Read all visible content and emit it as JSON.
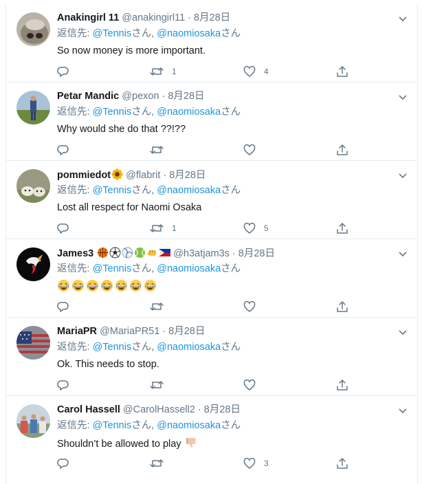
{
  "reply_prefix": "返信先: ",
  "reply_suffix": "さん",
  "reply_sep": ", ",
  "tweets": [
    {
      "name": "Anakingirl 11",
      "handle": "@anakingirl11",
      "dot": "·",
      "date": "8月28日",
      "reply_to": [
        "@Tennis",
        "@naomiosaka"
      ],
      "text": "So now money is more important.",
      "replies": "",
      "retweets": "1",
      "likes": "4"
    },
    {
      "name": "Petar Mandic",
      "handle": "@pexon",
      "dot": "·",
      "date": "8月28日",
      "reply_to": [
        "@Tennis",
        "@naomiosaka"
      ],
      "text": "Why would she do that ??!??",
      "replies": "",
      "retweets": "",
      "likes": ""
    },
    {
      "name": "pommiedot",
      "name_emoji": "sunflower-emoji",
      "handle": "@flabrit",
      "dot": "·",
      "date": "8月28日",
      "reply_to": [
        "@Tennis",
        "@naomiosaka"
      ],
      "text": "Lost all respect for Naomi Osaka",
      "replies": "",
      "retweets": "1",
      "likes": "5"
    },
    {
      "name": "James3",
      "name_emojis": [
        "basketball-emoji",
        "soccer-ball-emoji",
        "volleyball-emoji",
        "tennis-ball-emoji",
        "fist-emoji",
        "philippines-flag-emoji"
      ],
      "handle": "@h3atjam3s",
      "dot": "·",
      "date": "8月28日",
      "reply_to": [
        "@Tennis",
        "@naomiosaka"
      ],
      "text": "😂😂😂😂😂😂😂",
      "replies": "",
      "retweets": "",
      "likes": ""
    },
    {
      "name": "MariaPR",
      "handle": "@MariaPR51",
      "dot": "·",
      "date": "8月28日",
      "reply_to": [
        "@Tennis",
        "@naomiosaka"
      ],
      "text": "Ok. This needs to stop.",
      "replies": "",
      "retweets": "",
      "likes": ""
    },
    {
      "name": "Carol Hassell",
      "handle": "@CarolHassell2",
      "dot": "·",
      "date": "8月28日",
      "reply_to": [
        "@Tennis",
        "@naomiosaka"
      ],
      "text": "Shouldn’t be allowed to play",
      "text_emoji": "thumbs-down-emoji",
      "replies": "",
      "retweets": "",
      "likes": "3"
    }
  ],
  "colors": {
    "text": "#14171a",
    "secondary": "#657786",
    "link": "#1b95e0",
    "border": "#e6ecf0"
  }
}
